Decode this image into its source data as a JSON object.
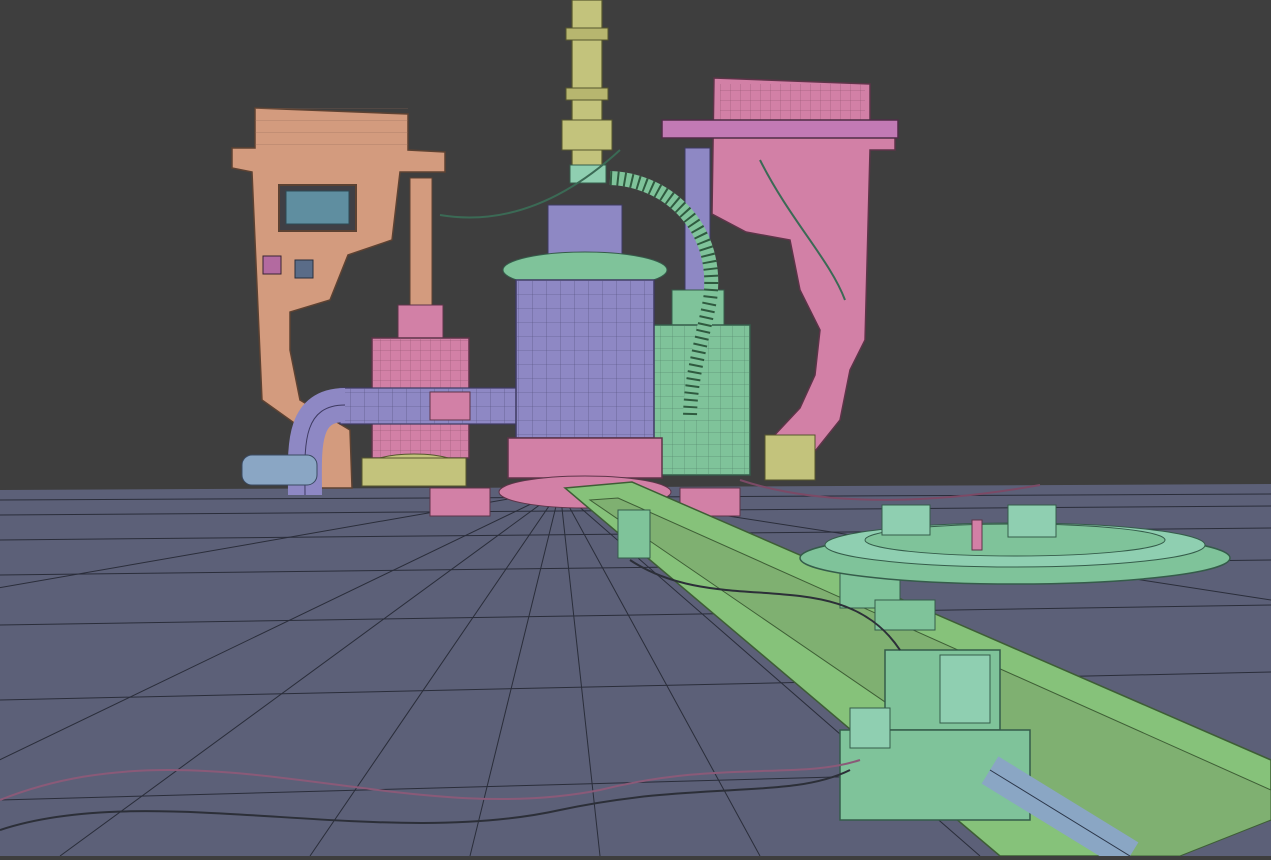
{
  "scene": {
    "kind": "3d-viewport-wireframe-render",
    "colors": {
      "background": "#3e3e3e",
      "floor": "#5c6078",
      "floor_wire": "#262936",
      "orange": "#d39b7e",
      "pink": "#d280a6",
      "lavender": "#8e88c4",
      "mint": "#7fc39a",
      "olive": "#c3c37c",
      "lime": "#86c27a",
      "wire": "#2c2f38"
    },
    "objects": [
      {
        "name": "left-orange-frame",
        "color": "orange"
      },
      {
        "name": "right-pink-frame",
        "color": "pink"
      },
      {
        "name": "center-lavender-tank",
        "color": "lavender"
      },
      {
        "name": "left-pink-tank",
        "color": "pink"
      },
      {
        "name": "right-mint-tank",
        "color": "mint"
      },
      {
        "name": "olive-top-column",
        "color": "olive"
      },
      {
        "name": "green-conveyor-rail",
        "color": "lime"
      },
      {
        "name": "green-machine-blocks",
        "color": "mint"
      },
      {
        "name": "circular-green-platform",
        "color": "mint"
      },
      {
        "name": "lavender-pipes",
        "color": "lavender"
      },
      {
        "name": "cables",
        "color": "wire"
      }
    ]
  }
}
